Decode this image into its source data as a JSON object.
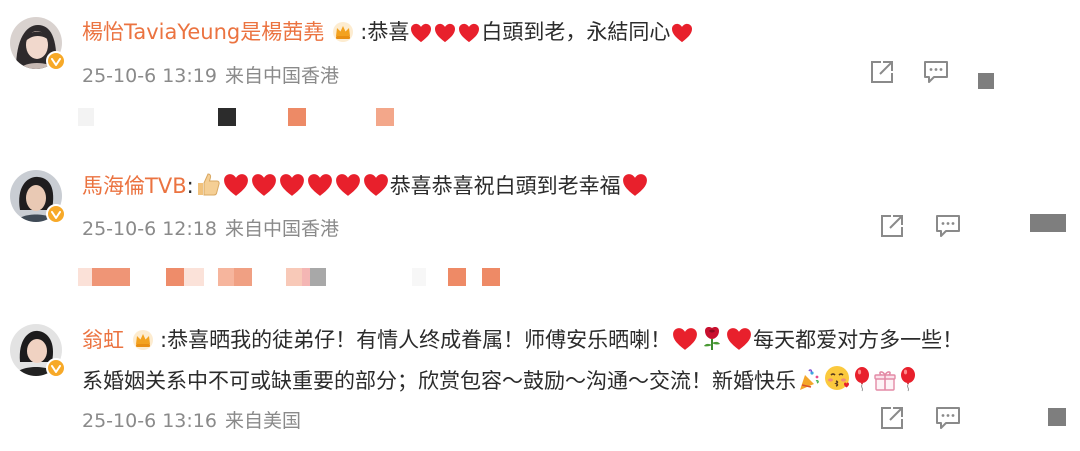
{
  "comments": [
    {
      "username": "楊怡TaviaYeung是楊茜堯",
      "has_crown_badge": true,
      "text_before": ":恭喜",
      "hearts_1": 3,
      "text_after": "白頭到老，永結同心",
      "hearts_2": 1,
      "timestamp": "25-10-6 13:19",
      "location": "来自中国香港",
      "actions": [
        "share-icon",
        "comment-icon"
      ]
    },
    {
      "username": "馬海倫TVB",
      "has_crown_badge": false,
      "text_before": ":",
      "thumbs_up": 1,
      "hearts_1": 6,
      "text_after": "恭喜恭喜祝白頭到老幸福",
      "hearts_2": 1,
      "timestamp": "25-10-6 12:18",
      "location": "来自中国香港",
      "actions": [
        "share-icon",
        "comment-icon"
      ]
    },
    {
      "username": "翁虹",
      "has_crown_badge": true,
      "text_line1_a": ":恭喜晒我的徒弟仔！有情人终成眷属！师傅安乐晒喇！",
      "text_line1_b": "每天都爱对方多一些！",
      "text_line2": "系婚姻关系中不可或缺重要的部分；欣赏包容～鼓励～沟通～交流！新婚快乐",
      "timestamp": "25-10-6 13:16",
      "location": "来自美国",
      "actions": [
        "share-icon",
        "comment-icon"
      ]
    }
  ],
  "colors": {
    "username": "#eb7340",
    "text": "#2b2b2b",
    "meta": "#8a8a8a",
    "heart": "#e8202c",
    "verified_badge": "#f7a928"
  }
}
